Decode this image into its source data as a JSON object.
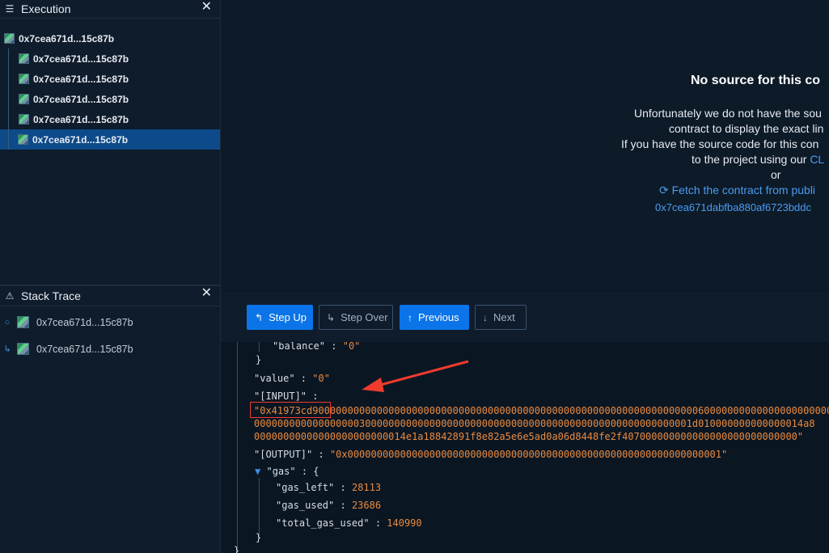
{
  "execution_panel": {
    "title": "Execution",
    "close": "✕",
    "nodes": [
      {
        "label": "0x7cea671d...15c87b"
      },
      {
        "label": "0x7cea671d...15c87b"
      },
      {
        "label": "0x7cea671d...15c87b"
      },
      {
        "label": "0x7cea671d...15c87b"
      },
      {
        "label": "0x7cea671d...15c87b"
      },
      {
        "label": "0x7cea671d...15c87b"
      }
    ]
  },
  "stack_trace_panel": {
    "title": "Stack Trace",
    "close": "✕",
    "items": [
      {
        "label": "0x7cea671d...15c87b",
        "icon": "circle-icon"
      },
      {
        "label": "0x7cea671d...15c87b",
        "icon": "step-into-icon"
      }
    ]
  },
  "no_source": {
    "title": "No source for this co",
    "line1": "Unfortunately we do not have the sou",
    "line2": "contract to display the exact lin",
    "line3a": "If you have the source code for this con",
    "line4a": "to the project using our",
    "line4b": "CL",
    "line5": "or",
    "fetch_link": "Fetch the contract from publi",
    "address_link": "0x7cea671dabfba880af6723bddc"
  },
  "toolbar": {
    "step_up": "Step Up",
    "step_over": "Step Over",
    "previous": "Previous",
    "next": "Next"
  },
  "json_view": {
    "balance_key": "\"balance\"",
    "balance_val": "\"0\"",
    "value_key": "\"value\"",
    "value_val": "\"0\"",
    "input_key": "\"[INPUT]\"",
    "input_line1": "\"0x41973cd90000000000000000000000000000000000000000000000000000000000000000060000000000000000000000000000000",
    "input_line2": "000000000000000000300000000000000000000000000000000000000000000000000000001d010000000000000014a8",
    "input_line3": "00000000000000000000000014e1a18842891f8e82a5e6e5ad0a06d8448fe2f407000000000000000000000000000\"",
    "output_key": "\"[OUTPUT]\"",
    "output_val": "\"0x0000000000000000000000000000000000000000000000000000000000000001\"",
    "gas_key": "\"gas\"",
    "gas_left_key": "\"gas_left\"",
    "gas_left_val": "28113",
    "gas_used_key": "\"gas_used\"",
    "gas_used_val": "23686",
    "total_gas_used_key": "\"total_gas_used\"",
    "total_gas_used_val": "140990"
  },
  "colors": {
    "accent": "#0a74e8",
    "selected_row": "#0d4a8a",
    "json_value": "#e98a3e",
    "annotation": "#ef3b2c"
  }
}
